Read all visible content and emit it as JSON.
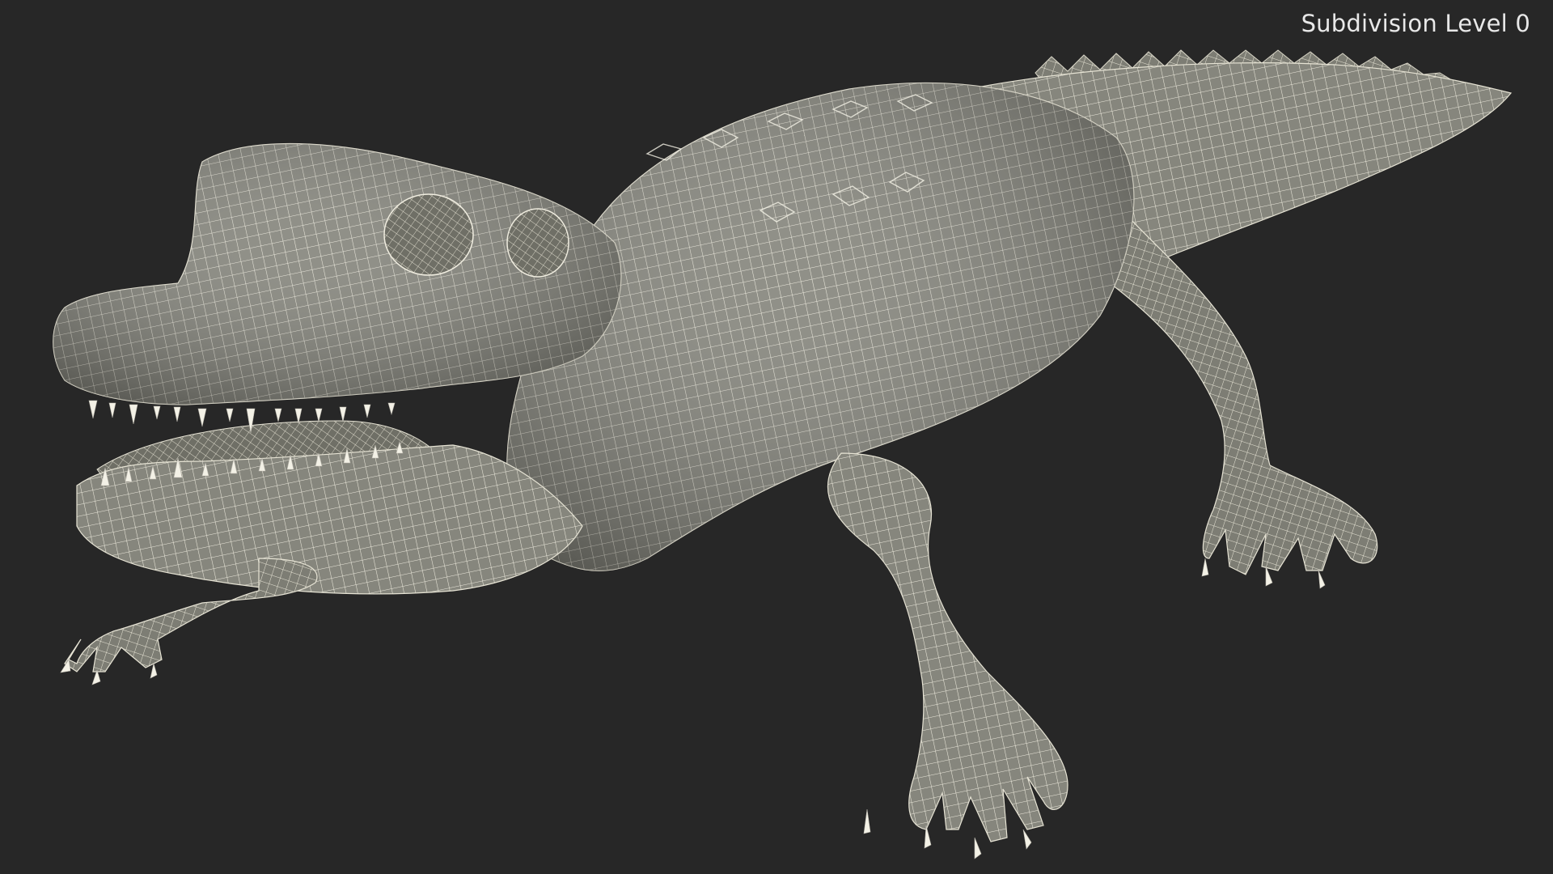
{
  "viewport": {
    "background": "#272727",
    "overlay_label": "Subdivision Level 0"
  },
  "model": {
    "subject": "alligator",
    "render_style": "wireframe",
    "mesh_fill": "#8a8a80",
    "wire_color": "#f2f0e4"
  }
}
